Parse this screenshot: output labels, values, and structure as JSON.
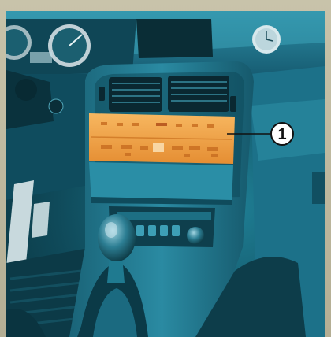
{
  "callouts": [
    {
      "label": "1"
    }
  ],
  "colors": {
    "interior_teal": "#1a7e96",
    "highlight_orange": "#f3a24b",
    "outer_frame": "#b9b39a"
  }
}
